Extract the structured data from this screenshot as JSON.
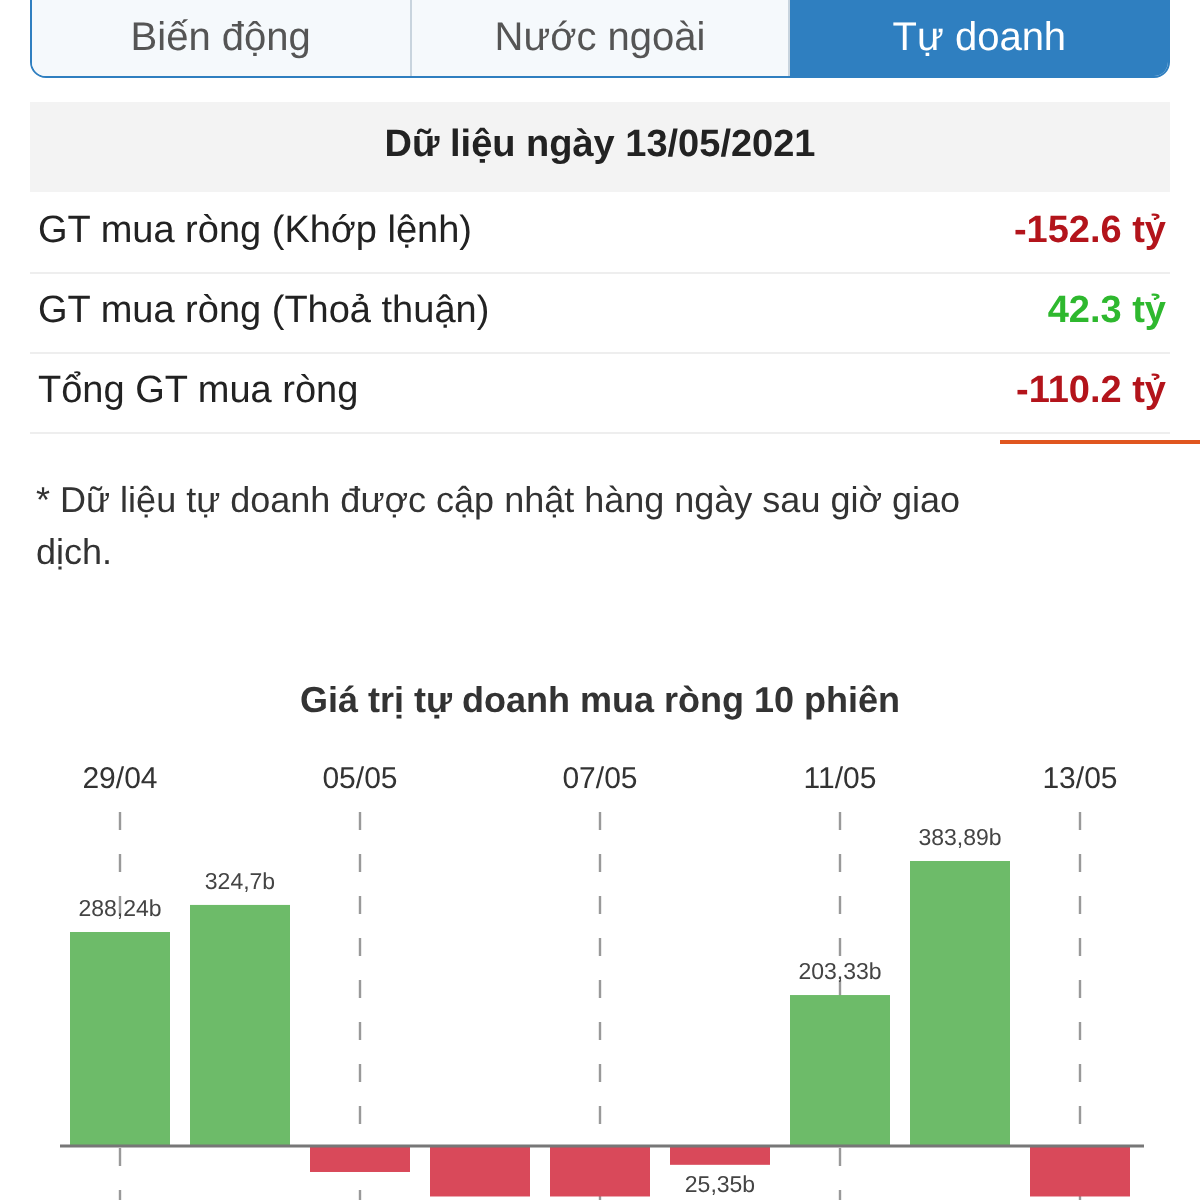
{
  "tabs": [
    {
      "label": "Biến động",
      "selected": false
    },
    {
      "label": "Nước ngoài",
      "selected": false
    },
    {
      "label": "Tự doanh",
      "selected": true
    }
  ],
  "summary": {
    "title": "Dữ liệu ngày 13/05/2021",
    "rows": [
      {
        "label": "GT mua ròng (Khớp lệnh)",
        "value": "-152.6 tỷ",
        "color": "#b3141b",
        "underlined": false
      },
      {
        "label": "GT mua ròng (Thoả thuận)",
        "value": "42.3 tỷ",
        "color": "#2eb82e",
        "underlined": false
      },
      {
        "label": "Tổng GT mua ròng",
        "value": "-110.2 tỷ",
        "color": "#b3141b",
        "underlined": true
      }
    ]
  },
  "note": "* Dữ liệu tự doanh được cập nhật hàng ngày sau giờ giao dịch.",
  "chart": {
    "chart_data": {
      "type": "bar",
      "title": "Giá trị tự doanh mua ròng 10 phiên",
      "categories": [
        "29/04",
        null,
        "05/05",
        null,
        "07/05",
        null,
        "11/05",
        null,
        "13/05"
      ],
      "grid": true,
      "values": [
        288.24,
        324.7,
        -35,
        -68,
        -68,
        -25.35,
        203.33,
        383.89,
        -68
      ],
      "value_labels": [
        "288,24b",
        "324,7b",
        null,
        null,
        null,
        null,
        "203,33b",
        "383,89b",
        null
      ],
      "annotations": [
        "25,35b"
      ]
    }
  }
}
